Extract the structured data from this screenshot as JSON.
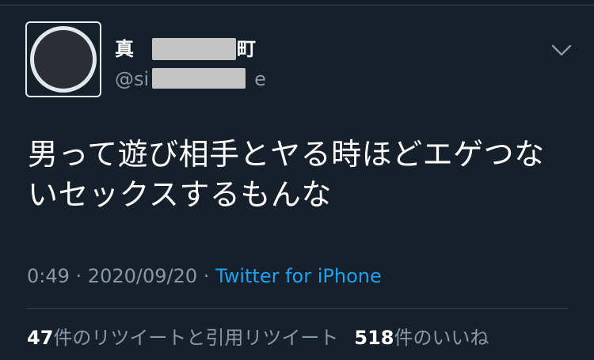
{
  "tweet": {
    "display_name": "真",
    "display_name_suffix": "町",
    "handle_prefix": "@si",
    "handle_suffix": "e",
    "text": "男って遊び相手とヤる時ほどエゲつないセックスするもんな",
    "time": "0:49",
    "separator": " · ",
    "date": "2020/09/20",
    "source": "Twitter for iPhone",
    "retweet_count": "47",
    "retweet_label": "件のリツイートと引用リツイート",
    "like_count": "518",
    "like_label": "件のいいね"
  },
  "icons": {
    "menu": "chevron-down-icon",
    "avatar": "avatar"
  },
  "colors": {
    "background": "#15202b",
    "secondary_text": "#8899a6",
    "link": "#1da1f2",
    "divider": "#38444d"
  }
}
